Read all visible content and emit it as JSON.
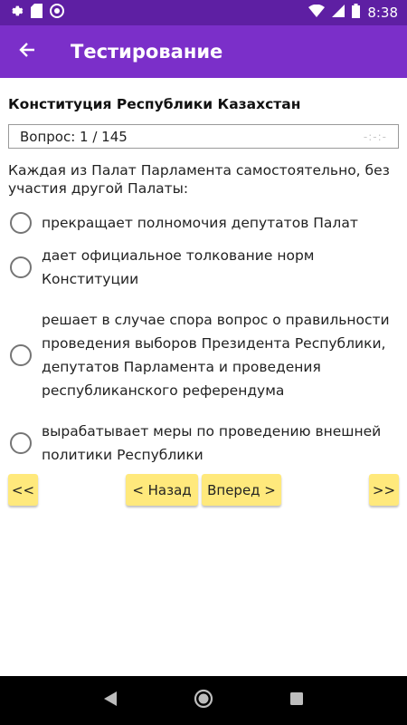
{
  "status_bar": {
    "time": "8:38",
    "icons_left": [
      "gear-icon",
      "sd-card-icon",
      "circle-sync-icon"
    ],
    "icons_right": [
      "wifi-icon",
      "signal-icon",
      "battery-icon"
    ]
  },
  "app_bar": {
    "title": "Тестирование",
    "back_icon": "arrow-back-icon",
    "color": "#7b2fc9",
    "status_color": "#5e1fa3"
  },
  "test": {
    "section_title": "Конституция Республики Казахстан",
    "question_counter": "Вопрос: 1 / 145",
    "timer": "-:-:-",
    "question": "Каждая из Палат Парламента самостоятельно, без участия другой Палаты:",
    "answers": [
      "прекращает полномочия депутатов Палат",
      "дает официальное толкование норм Конституции",
      "решает в случае спора вопрос о правильности проведения выборов Президента Республики, депутатов Парламента и проведения республиканского референдума",
      "вырабатывает меры по проведению внешней политики Республики"
    ]
  },
  "navigation": {
    "first": "<<",
    "back": "< Назад",
    "forward": "Вперед >",
    "last": ">>",
    "button_color": "#ffe97c"
  },
  "system_nav": {
    "icons": [
      "back-triangle-icon",
      "home-circle-icon",
      "recents-square-icon"
    ]
  }
}
